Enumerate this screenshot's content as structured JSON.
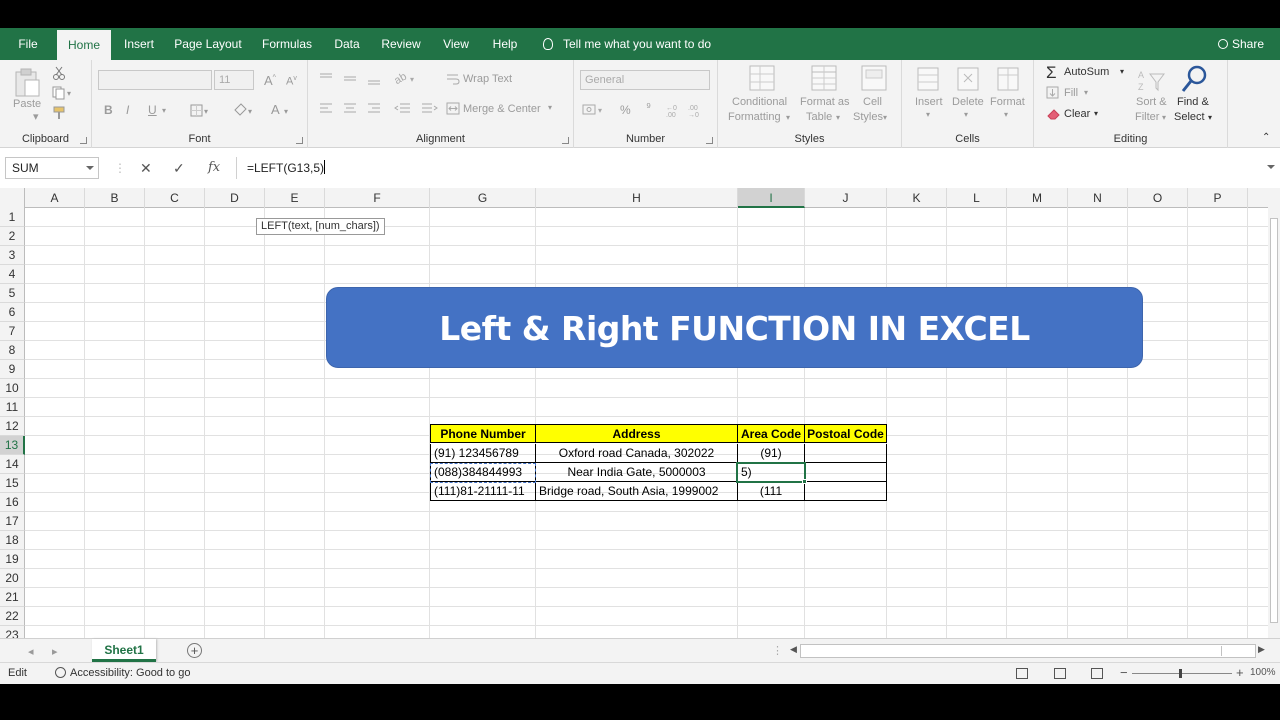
{
  "menu": {
    "tabs": [
      "File",
      "Home",
      "Insert",
      "Page Layout",
      "Formulas",
      "Data",
      "Review",
      "View",
      "Help"
    ],
    "active": "Home",
    "tell_me": "Tell me what you want to do",
    "share": "Share"
  },
  "ribbon": {
    "clipboard": {
      "label": "Clipboard",
      "paste": "Paste"
    },
    "font": {
      "label": "Font",
      "font_name": "",
      "font_size": "11",
      "bold": "B",
      "italic": "I",
      "underline": "U"
    },
    "alignment": {
      "label": "Alignment",
      "wrap_text": "Wrap Text",
      "merge_center": "Merge & Center"
    },
    "number": {
      "label": "Number",
      "format": "General",
      "percent": "%",
      "comma": "⁹"
    },
    "styles": {
      "label": "Styles",
      "conditional": "Conditional",
      "formatting": "Formatting",
      "format_as": "Format as",
      "table": "Table",
      "cell": "Cell",
      "cell_styles": "Styles"
    },
    "cells": {
      "label": "Cells",
      "insert": "Insert",
      "delete": "Delete",
      "format": "Format"
    },
    "editing": {
      "label": "Editing",
      "autosum": "AutoSum",
      "fill": "Fill",
      "clear": "Clear",
      "sort": "Sort &",
      "filter": "Filter",
      "find": "Find &",
      "select": "Select"
    }
  },
  "formula_bar": {
    "name_box": "SUM",
    "cancel": "✕",
    "enter": "✓",
    "fx": "fx",
    "formula": "=LEFT(G13,5)",
    "tooltip": "LEFT(text, [num_chars])"
  },
  "grid": {
    "columns": [
      "A",
      "B",
      "C",
      "D",
      "E",
      "F",
      "G",
      "H",
      "I",
      "J",
      "K",
      "L",
      "M",
      "N",
      "O",
      "P"
    ],
    "rows": [
      "1",
      "2",
      "3",
      "4",
      "5",
      "6",
      "7",
      "8",
      "9",
      "10",
      "11",
      "12",
      "13",
      "14",
      "15",
      "16",
      "17",
      "18",
      "19",
      "20",
      "21",
      "22",
      "23"
    ],
    "selected_column": "I",
    "selected_row": "13",
    "banner": "Left & Right FUNCTION IN EXCEL",
    "table": {
      "headers": [
        "Phone Number",
        "Address",
        "Area Code",
        "Postoal Code"
      ],
      "rows": [
        [
          "(91) 123456789",
          "Oxford road Canada, 302022",
          "(91)",
          ""
        ],
        [
          "(088)384844993",
          "Near India Gate, 5000003",
          "5)",
          ""
        ],
        [
          "(111)81-21111-11",
          "Bridge road, South Asia,  1999002",
          "(111",
          ""
        ]
      ]
    }
  },
  "sheets": {
    "active": "Sheet1"
  },
  "status": {
    "mode": "Edit",
    "accessibility": "Accessibility: Good to go",
    "zoom": "100%"
  }
}
